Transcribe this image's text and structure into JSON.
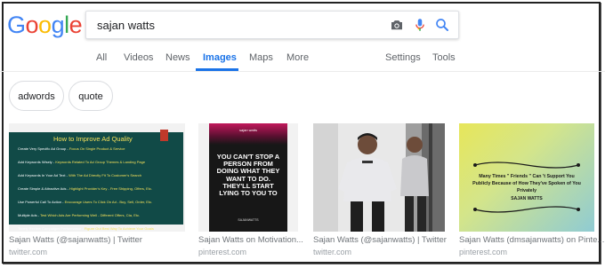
{
  "search": {
    "query": "sajan watts"
  },
  "logo": {
    "letters": [
      "G",
      "o",
      "o",
      "g",
      "l",
      "e"
    ],
    "colors": [
      "#4285F4",
      "#EA4335",
      "#FBBC05",
      "#4285F4",
      "#34A853",
      "#EA4335"
    ]
  },
  "tabs": [
    {
      "label": "All"
    },
    {
      "label": "Videos"
    },
    {
      "label": "News"
    },
    {
      "label": "Images"
    },
    {
      "label": "Maps"
    },
    {
      "label": "More"
    }
  ],
  "tools": {
    "settings": "Settings",
    "tools": "Tools"
  },
  "chips": [
    "adwords",
    "quote"
  ],
  "results": [
    {
      "title": "Sajan Watts (@sajanwatts) | Twitter",
      "source": "twitter.com",
      "image": {
        "heading": "How to Improve Ad Quality",
        "rows": [
          {
            "a": "Create Very Specific Ad Group -",
            "b": "Focus On Single Product & Service"
          },
          {
            "a": "Add Keywords Wisely -",
            "b": "Keywords Related To Ad Group Themes & Landing Page"
          },
          {
            "a": "Add Keywords In Your Ad Text -",
            "b": "With The Ad Directly Fit To Customer's Search"
          },
          {
            "a": "Create Simple & Attractive Ads -",
            "b": "Highlight Provider's Key - Free Shipping, Offers, Etc."
          },
          {
            "a": "Use Powerful Call To Action -",
            "b": "Encourage Users To Click On Ad - Buy, Sell, Order, Etc."
          },
          {
            "a": "Multiple Ads -",
            "b": "Test Which Ads Are Performing Well - Different Offers, Cta, Etc."
          },
          {
            "a": "Timely Review Campaigns Performance -",
            "b": "Figure Out Best Way To Achieve Your Goals"
          }
        ]
      }
    },
    {
      "title": "Sajan Watts on Motivation...",
      "source": "pinterest.com",
      "image": {
        "top": "sajan watts",
        "quote": "YOU CAN'T STOP A PERSON FROM DOING WHAT THEY WANT TO DO. THEY'LL START LYING TO YOU TO",
        "sign": "SAJANWATTS"
      }
    },
    {
      "title": "Sajan Watts (@sajanwatts) | Twitter",
      "source": "twitter.com",
      "image": {}
    },
    {
      "title": "Sajan Watts (dmsajanwatts) on Pinte...",
      "source": "pinterest.com",
      "image": {
        "quote": "Many Times \" Friends \" Can 't Support You Publicly Because of How They've Spoken of You Privately",
        "sign": "SAJAN WATTS"
      }
    }
  ]
}
